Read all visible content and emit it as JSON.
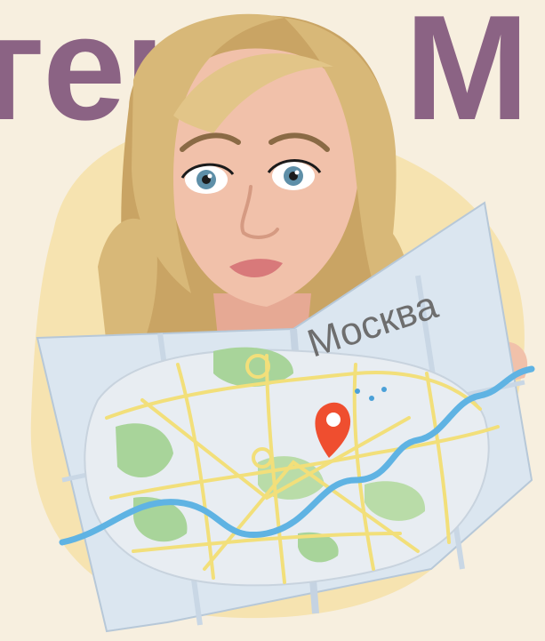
{
  "headline": {
    "text": "генте М"
  },
  "map": {
    "city_label": "Москва"
  },
  "colors": {
    "background": "#f7efdf",
    "headline": "#8b6384",
    "blob": "#f6e3b0",
    "map_paper": "#dbe6f0",
    "park": "#a8d49a",
    "road": "#f2df7a",
    "river": "#5fb3e3",
    "pin": "#ef4e2f",
    "hair": "#d8b878",
    "skin": "#f1c1aa"
  },
  "icons": {
    "pin": "map-pin-icon"
  }
}
